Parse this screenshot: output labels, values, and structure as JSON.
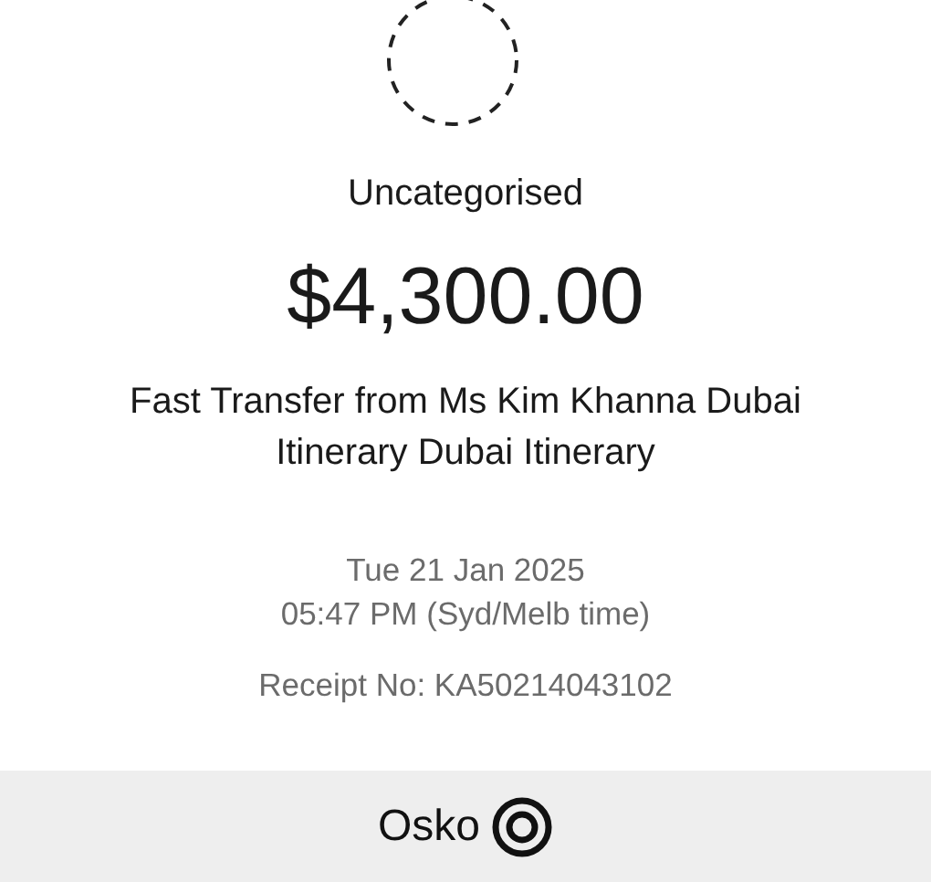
{
  "category": "Uncategorised",
  "amount": "$4,300.00",
  "description": "Fast Transfer from Ms Kim Khanna Dubai Itinerary Dubai Itinerary",
  "date": "Tue 21 Jan 2025",
  "time": "05:47 PM (Syd/Melb time)",
  "receipt": "Receipt No: KA50214043102",
  "footer": {
    "brand": "Osko"
  }
}
